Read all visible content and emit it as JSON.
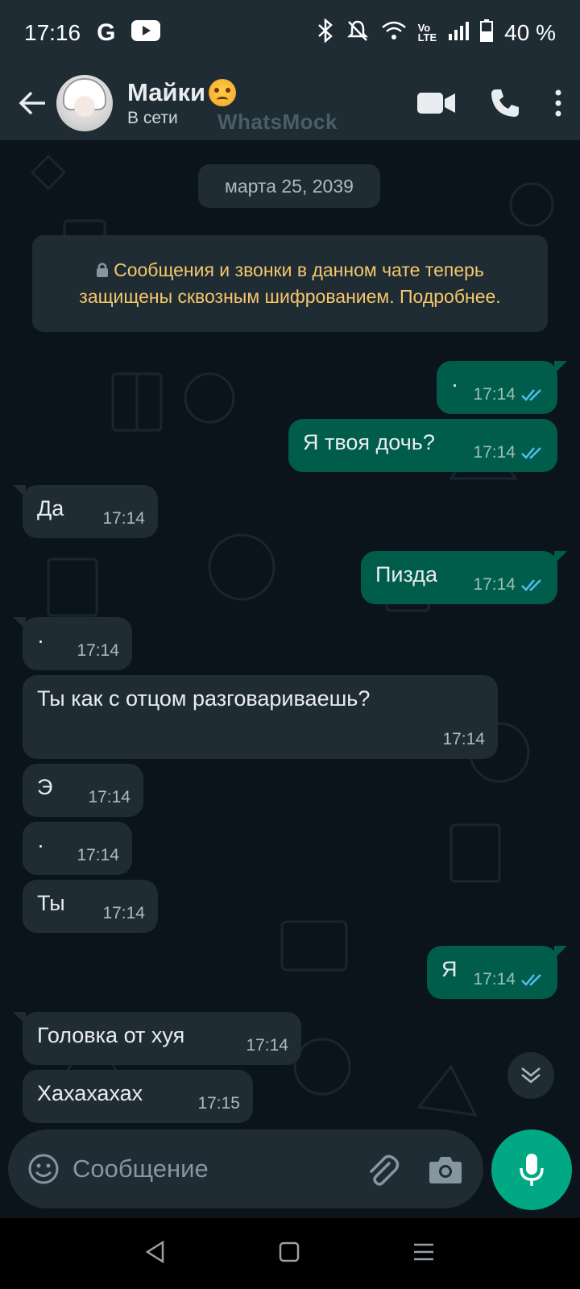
{
  "status_bar": {
    "time": "17:16",
    "battery": "40 %"
  },
  "header": {
    "contact_name": "Майки",
    "contact_status": "В сети",
    "watermark": "WhatsMock"
  },
  "chat": {
    "date": "марта 25, 2039",
    "encryption_notice": "Сообщения и звонки в данном чате теперь защищены сквозным шифрованием. Подробнее.",
    "messages": [
      {
        "direction": "out",
        "text": "·",
        "time": "17:14",
        "read": true
      },
      {
        "direction": "out",
        "text": "Я твоя дочь?",
        "time": "17:14",
        "read": true
      },
      {
        "direction": "in",
        "text": "Да",
        "time": "17:14"
      },
      {
        "direction": "out",
        "text": "Пизда",
        "time": "17:14",
        "read": true
      },
      {
        "direction": "in",
        "text": "·",
        "time": "17:14"
      },
      {
        "direction": "in",
        "text": "Ты как с отцом разговариваешь?",
        "time": "17:14"
      },
      {
        "direction": "in",
        "text": "Э",
        "time": "17:14"
      },
      {
        "direction": "in",
        "text": "·",
        "time": "17:14"
      },
      {
        "direction": "in",
        "text": "Ты",
        "time": "17:14"
      },
      {
        "direction": "out",
        "text": "Я",
        "time": "17:14",
        "read": true
      },
      {
        "direction": "in",
        "text": "Головка от хуя",
        "time": "17:14"
      },
      {
        "direction": "in",
        "text": "Хахахахах",
        "time": "17:15"
      }
    ]
  },
  "composer": {
    "placeholder": "Сообщение"
  },
  "colors": {
    "background": "#0b141a",
    "bar": "#1f2c34",
    "outgoing_bubble": "#005c4b",
    "incoming_bubble": "#202c33",
    "accent": "#00a884",
    "read_ticks": "#53bdeb",
    "notice_text": "#f5c66b"
  },
  "icons": [
    "back-arrow-icon",
    "video-call-icon",
    "phone-icon",
    "more-vert-icon",
    "lock-icon",
    "double-check-icon",
    "chevron-down-icon",
    "emoji-icon",
    "attach-icon",
    "camera-icon",
    "mic-icon",
    "nav-back-icon",
    "nav-home-icon",
    "nav-recents-icon"
  ]
}
